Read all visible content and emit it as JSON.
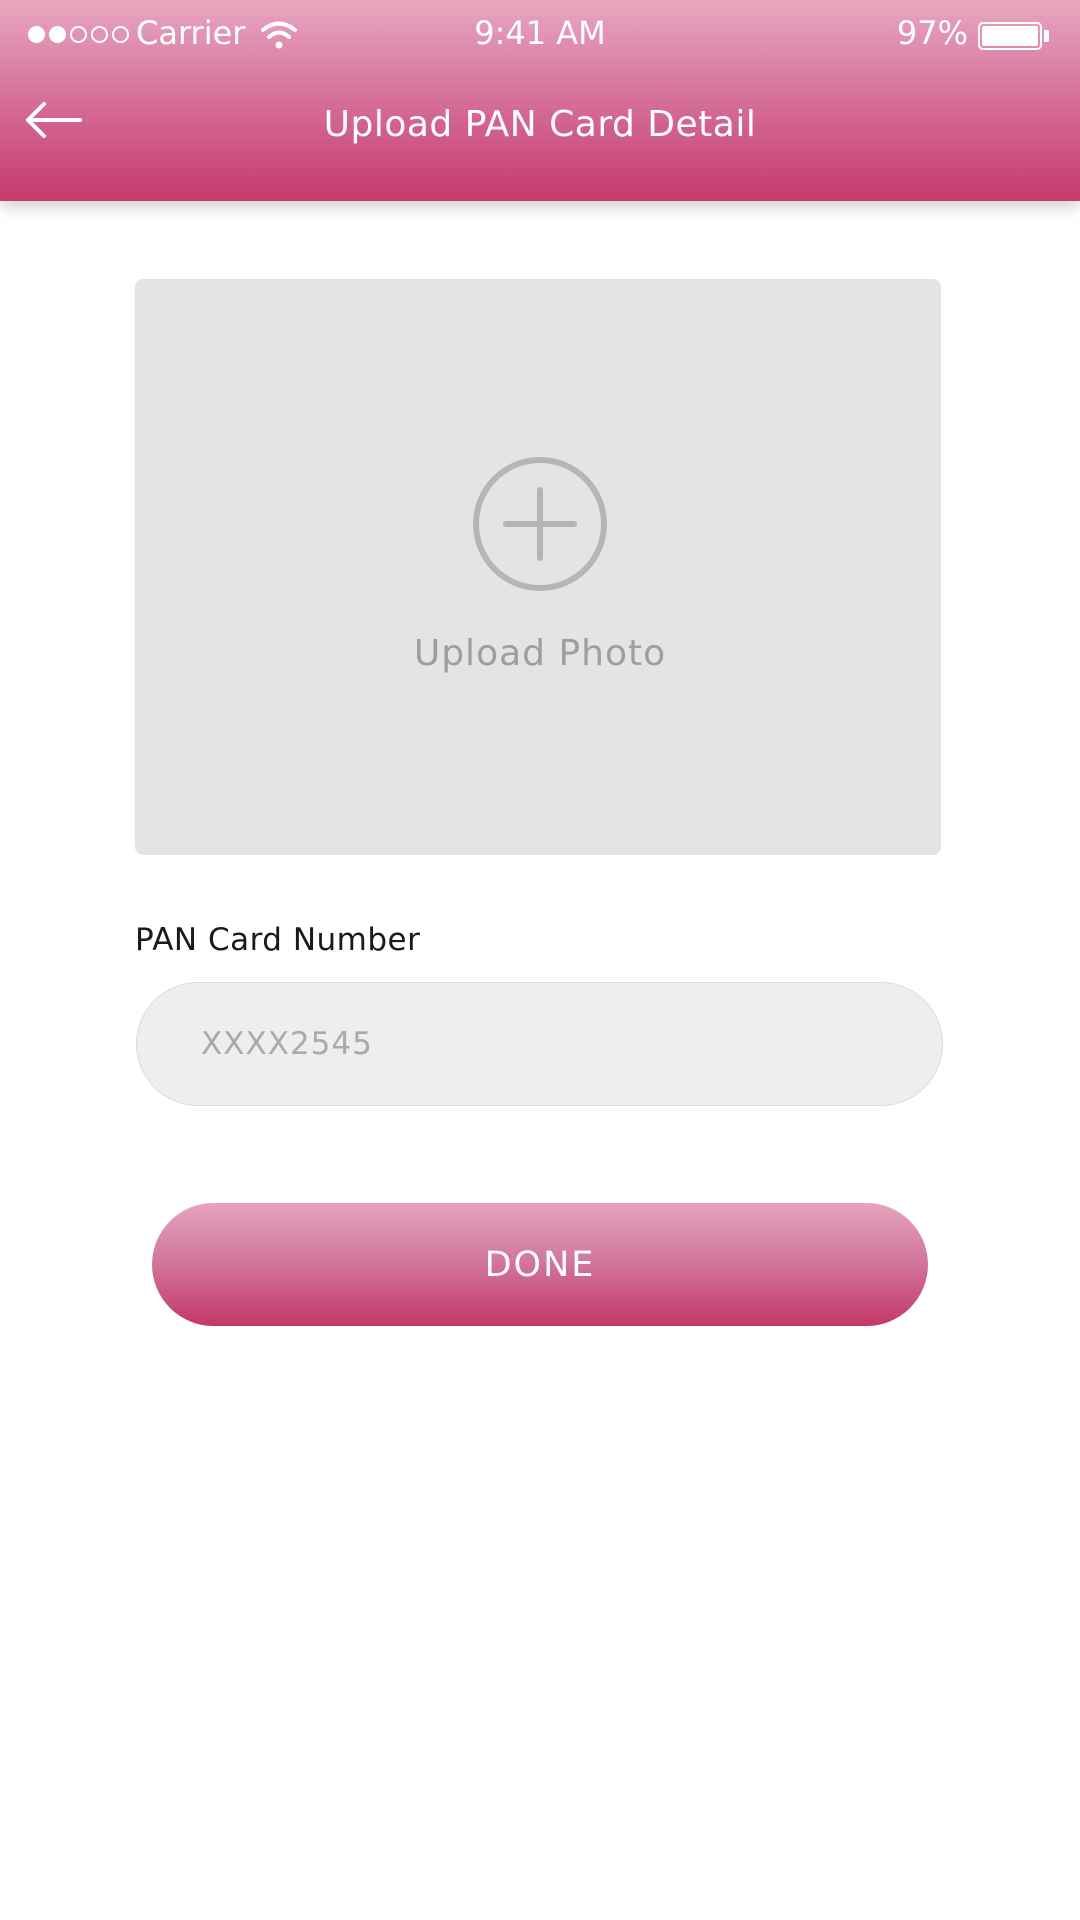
{
  "status_bar": {
    "carrier": "Carrier",
    "time": "9:41 AM",
    "battery": "97%",
    "signal_icon": "signal-dots-icon",
    "wifi_icon": "wifi-icon",
    "battery_icon": "battery-icon"
  },
  "header": {
    "title": "Upload PAN Card Detail",
    "back_icon": "arrow-left-icon"
  },
  "upload": {
    "label": "Upload Photo",
    "icon": "plus-circle-icon"
  },
  "form": {
    "pan_label": "PAN Card Number",
    "pan_placeholder": "XXXX2545",
    "pan_value": ""
  },
  "actions": {
    "done_label": "DONE"
  },
  "colors": {
    "header_gradient_top": "#e8a8c0",
    "header_gradient_bottom": "#c43a6c",
    "upload_background": "#e4e4e4",
    "input_background": "#eeeeee",
    "icon_gray": "#b5b5b5"
  }
}
